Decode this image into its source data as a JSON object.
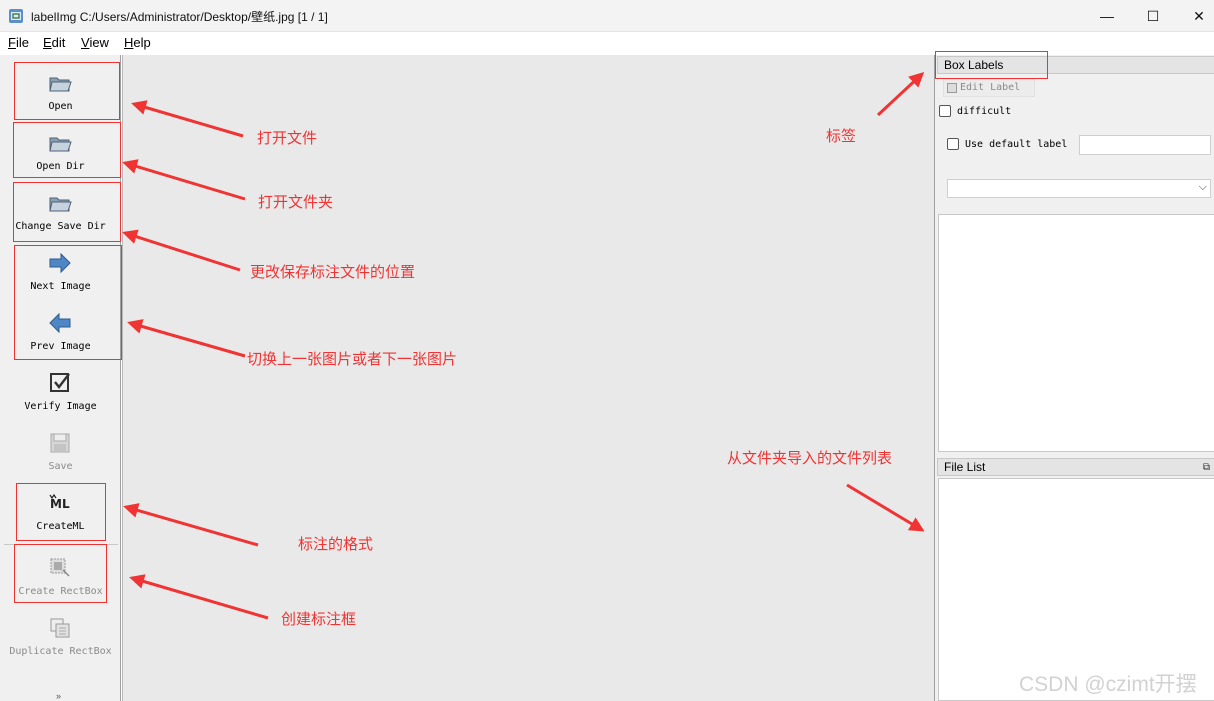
{
  "window": {
    "title": "labelImg C:/Users/Administrator/Desktop/壁纸.jpg [1 / 1]",
    "controls": {
      "minimize": "—",
      "maximize": "☐",
      "close": "✕"
    }
  },
  "menu": [
    {
      "accel": "F",
      "rest": "ile"
    },
    {
      "accel": "E",
      "rest": "dit"
    },
    {
      "accel": "V",
      "rest": "iew"
    },
    {
      "accel": "H",
      "rest": "elp"
    }
  ],
  "toolbar": {
    "open": "Open",
    "open_dir": "Open Dir",
    "change_save_dir": "Change Save Dir",
    "next_image": "Next Image",
    "prev_image": "Prev Image",
    "verify_image": "Verify Image",
    "save": "Save",
    "format": "CreateML",
    "create_rectbox": "Create RectBox",
    "duplicate_rectbox": "Duplicate RectBox",
    "more": "»"
  },
  "box_labels": {
    "title": "Box Labels",
    "edit_label": "Edit Label",
    "difficult": "difficult",
    "use_default_label": "Use default label",
    "default_label_value": "",
    "selected_label": ""
  },
  "file_list": {
    "title": "File List"
  },
  "annotations": {
    "open": "打开文件",
    "open_dir": "打开文件夹",
    "change_save_dir": "更改保存标注文件的位置",
    "switch_image": "切换上一张图片或者下一张图片",
    "format": "标注的格式",
    "create_box": "创建标注框",
    "labels": "标签",
    "file_list": "从文件夹导入的文件列表"
  },
  "watermark": "CSDN @czimt开摆",
  "colors": {
    "annotation": "#f03434",
    "canvas": "#e9e9e9",
    "panel": "#f0f0f0"
  }
}
